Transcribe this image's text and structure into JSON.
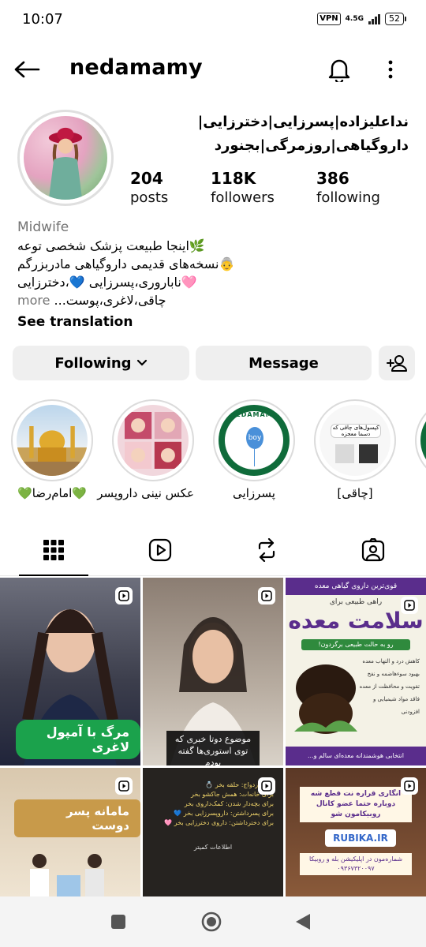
{
  "status": {
    "time": "10:07",
    "vpn": "VPN",
    "network": "4.5G",
    "battery": "52"
  },
  "header": {
    "username": "nedamamy"
  },
  "profile": {
    "full_name": "نداعلیزاده|پسرزایی|دخترزایی|داروگیاهی|روزمرگی|بجنورد",
    "stats": [
      {
        "value": "204",
        "label": "posts"
      },
      {
        "value": "118K",
        "label": "followers"
      },
      {
        "value": "386",
        "label": "following"
      }
    ],
    "category": "Midwife",
    "bio_lines": [
      "🌿اینجا طبیعت پزشک شخصی توعه",
      "👵نسخه‌های قدیمی داروگیاهی مادربزرگم",
      "🩷ناباروری،پسرزایی 💙،دخترزایی",
      "چاقی،لاغری،پوست..."
    ],
    "more_label": "more",
    "see_translation": "See translation"
  },
  "actions": {
    "following_label": "Following",
    "message_label": "Message"
  },
  "highlights": [
    {
      "label": "💚امام‌رضا💚",
      "icon": "shrine-photo"
    },
    {
      "label": "عکس نینی داروپسر",
      "icon": "baby-photos"
    },
    {
      "label": "پسرزایی",
      "icon": "boy-balloon-logo"
    },
    {
      "label": "[چاقی]",
      "icon": "capsules-flyer"
    },
    {
      "label": "\\",
      "icon": "partial-highlight"
    }
  ],
  "highlight_texts": {
    "logo_text": "NEDAMAMY",
    "balloon_text": "boy",
    "flyer_title": "کپسول‌های چاقی که",
    "flyer_sub": "دسما معجزه"
  },
  "tabs": [
    "grid-icon",
    "reels-icon",
    "reposts-icon",
    "tagged-icon"
  ],
  "posts": [
    {
      "type": "reel",
      "caption": "مرگ با آمپول لاغری"
    },
    {
      "type": "reel",
      "caption": "موضوع دوتا خبری که توی استوری‌ها گفته بودم"
    },
    {
      "type": "reel",
      "title": "سلامت معده",
      "top": "قوی‌ترین داروی گیاهی معده",
      "sub": "راهی طبیعی برای",
      "tag": "رو به حالت طبیعی برگردون!",
      "items": [
        "کاهش درد و التهاب معده",
        "بهبود سوءهاضمه و نفخ",
        "تقویت و محافظت از معده",
        "فاقد مواد شیمیایی و افزودنی"
      ],
      "bottom": "انتخابی هوشمندانه معده‌ای سالم و..."
    },
    {
      "type": "reel",
      "caption": "ماما‌نه پسر دوست"
    },
    {
      "type": "reel",
      "lines": [
        "برای ازدواج: حلقه بخر 💍",
        "برای خانه‌ات: همش جاکشو بخر",
        "برای بچه‌دار شدن: کمک‌داروی بخر",
        "برای پسرداشتن: داروپسرزایی بخر 💙",
        "برای دخترداشتن: داروی دخترزایی بخر 🩷"
      ],
      "footer": "اطلاعات کمیتر"
    },
    {
      "type": "reel",
      "banner": "انگاری قراره نت قطع شه دوباره حتما عضو کانال روبیکامون شو",
      "rubika": "RUBIKA.IR",
      "phone_line": "شماره‌مون در اپلیکیشن بله و روبیکا",
      "phone": "۰۹۳۶۷۳۲۰۰۹۷"
    }
  ],
  "colors": {
    "accent_green": "#1ba24c",
    "highlight_ring": "#dbdbdb",
    "button_bg": "#efefef",
    "muted_text": "#737373"
  }
}
